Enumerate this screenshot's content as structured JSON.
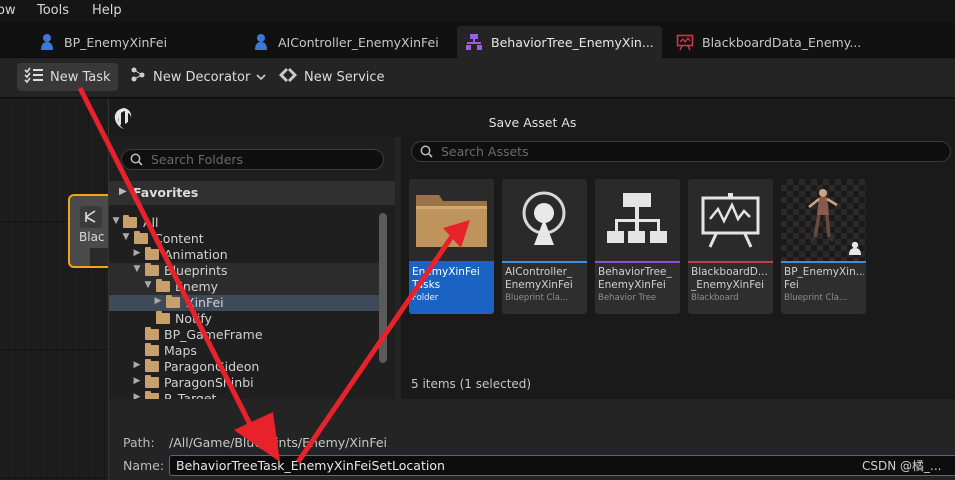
{
  "menu": {
    "items": [
      "ow",
      "Tools",
      "Help"
    ]
  },
  "tabs": [
    {
      "label": "BP_EnemyXinFei",
      "icon": "blueprint-pawn-icon",
      "active": false
    },
    {
      "label": "AIController_EnemyXinFei",
      "icon": "aicontroller-pawn-icon",
      "active": false
    },
    {
      "label": "BehaviorTree_EnemyXin...",
      "icon": "behavior-tree-icon",
      "active": true,
      "close": "×"
    },
    {
      "label": "BlackboardData_Enemy...",
      "icon": "blackboard-icon",
      "active": false
    }
  ],
  "toolbar": {
    "new_task": "New Task",
    "new_decorator": "New Decorator",
    "new_service": "New Service"
  },
  "graph": {
    "node_label": "Blac"
  },
  "dialog": {
    "title": "Save Asset As",
    "folders": {
      "search_placeholder": "Search Folders",
      "favorites_label": "Favorites",
      "tree": [
        {
          "label": "All",
          "indent": 0,
          "expanded": true
        },
        {
          "label": "Content",
          "indent": 1,
          "expanded": true
        },
        {
          "label": "Animation",
          "indent": 2,
          "expanded": false
        },
        {
          "label": "Blueprints",
          "indent": 2,
          "expanded": true
        },
        {
          "label": "Enemy",
          "indent": 3,
          "expanded": true
        },
        {
          "label": "XinFei",
          "indent": 4,
          "expanded": false,
          "selected": true
        },
        {
          "label": "Notify",
          "indent": 3,
          "expanded": null
        },
        {
          "label": "BP_GameFrame",
          "indent": 2,
          "expanded": null
        },
        {
          "label": "Maps",
          "indent": 2,
          "expanded": null
        },
        {
          "label": "ParagonGideon",
          "indent": 2,
          "expanded": false
        },
        {
          "label": "ParagonShinbi",
          "indent": 2,
          "expanded": false
        },
        {
          "label": "P_Target",
          "indent": 2,
          "expanded": false
        }
      ]
    },
    "assets": {
      "search_placeholder": "Search Assets",
      "items": [
        {
          "name": "EnemyXinFei\nTasks",
          "type": "Folder",
          "selected": true,
          "stripe": "#1a63c2"
        },
        {
          "name": "AIController_\nEnemyXinFei",
          "type": "Blueprint Cla...",
          "selected": false,
          "stripe": "#3f8de0"
        },
        {
          "name": "BehaviorTree_\nEnemyXinFei",
          "type": "Behavior Tree",
          "selected": false,
          "stripe": "#8c4fd9"
        },
        {
          "name": "BlackboardD...\n_EnemyXinFei",
          "type": "Blackboard",
          "selected": false,
          "stripe": "#b93f4e"
        },
        {
          "name": "BP_EnemyXin...\nFei",
          "type": "Blueprint Cla...",
          "selected": false,
          "stripe": "#3f8de0"
        }
      ],
      "count": "5 items (1 selected)"
    },
    "path_label": "Path:",
    "path_value": "/All/Game/Blueprints/Enemy/XinFei",
    "name_label": "Name:",
    "name_value": "BehaviorTreeTask_EnemyXinFeiSetLocation"
  },
  "watermark": "CSDN @橘_..."
}
